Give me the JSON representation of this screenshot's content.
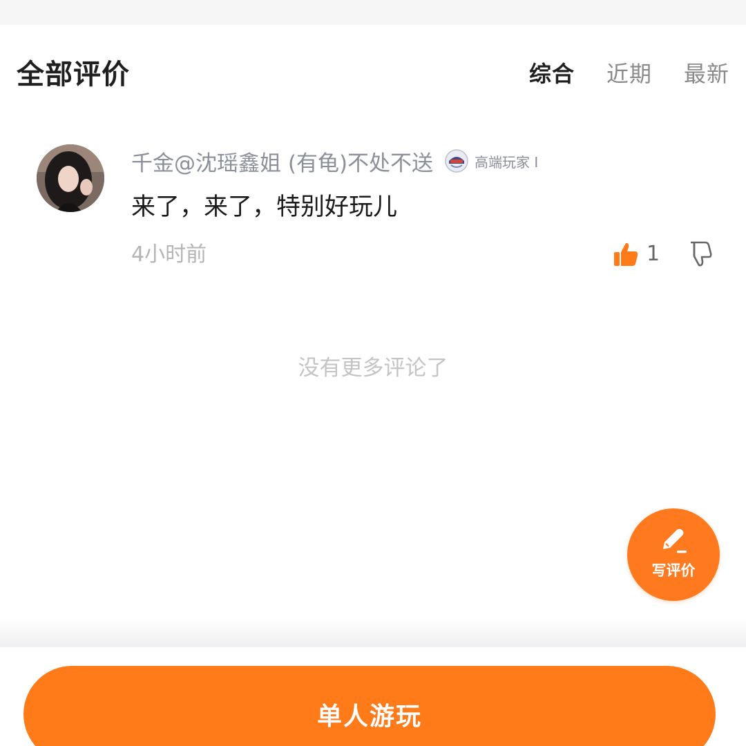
{
  "header": {
    "title": "全部评价",
    "sort_tabs": [
      {
        "label": "综合",
        "active": true
      },
      {
        "label": "近期",
        "active": false
      },
      {
        "label": "最新",
        "active": false
      }
    ]
  },
  "comments": [
    {
      "username": "千金@沈瑶鑫姐 (有龟)不处不送",
      "badge_text": "高端玩家 I",
      "text": "来了，来了，特别好玩儿",
      "time": "4小时前",
      "likes": "1"
    }
  ],
  "no_more_text": "没有更多评论了",
  "fab": {
    "label": "写评价",
    "icon": "pencil-icon"
  },
  "bottom": {
    "play_label": "单人游玩"
  },
  "colors": {
    "accent": "#ff7a18",
    "active_tab": "#1f1f1f",
    "inactive_tab": "#8a8a8a",
    "meta_text": "#b4b4b4"
  }
}
